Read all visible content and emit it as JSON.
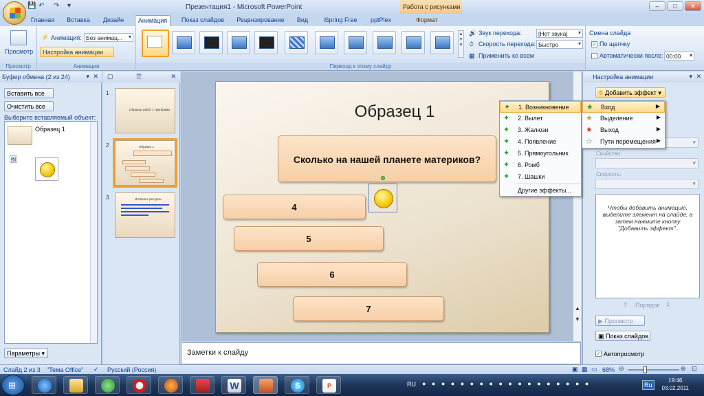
{
  "window": {
    "title": "Презентация1 - Microsoft PowerPoint",
    "context_tab": "Работа с рисунками"
  },
  "tabs": [
    "Главная",
    "Вставка",
    "Дизайн",
    "Анимация",
    "Показ слайдов",
    "Рецензирование",
    "Вид",
    "iSpring Free",
    "pptPlex",
    "Формат"
  ],
  "active_tab": "Анимация",
  "ribbon": {
    "preview_label": "Просмотр",
    "preview_group": "Просмотр",
    "animation_label": "Анимация:",
    "animation_value": "Без анимац...",
    "custom_anim_button": "Настройка анимации",
    "animation_group": "Анимация",
    "transition_sound_label": "Звук перехода:",
    "transition_sound_value": "[Нет звука]",
    "transition_speed_label": "Скорость перехода:",
    "transition_speed_value": "Быстро",
    "apply_all": "Применить ко всем",
    "transition_group": "Переход к этому слайду",
    "change_slide_label": "Смена слайда",
    "on_click_label": "По щелчку",
    "auto_after_label": "Автоматически после:",
    "auto_after_value": "00:00"
  },
  "clipboard": {
    "header": "Буфер обмена (2 из 24)",
    "paste_all": "Вставить все",
    "clear_all": "Очистить все",
    "choose_label": "Выберите вставляемый объект:",
    "item1_text": "Образец 1",
    "params_button": "Параметры"
  },
  "thumbnails": [
    {
      "num": "1",
      "text": "Образцы работ с тригерами"
    },
    {
      "num": "2",
      "text": "Образец 1"
    },
    {
      "num": "3",
      "text": "Интернет-ресурсы"
    }
  ],
  "slide": {
    "title": "Образец 1",
    "question": "Сколько на нашей планете материков?",
    "answers": [
      "4",
      "5",
      "6",
      "7"
    ]
  },
  "notes": {
    "placeholder": "Заметки к слайду"
  },
  "anim_pane": {
    "header": "Настройка анимации",
    "add_effect": "Добавить эффект",
    "property_label": "Свойство:",
    "speed_label": "Скорость:",
    "hint": "Чтобы добавить анимацию, выделите элемент на слайде, а затем нажмите кнопку \"Добавить эффект\".",
    "order_label": "Порядок",
    "preview_button": "Просмотр",
    "slideshow_button": "Показ слайдов",
    "autopreview_label": "Автопросмотр"
  },
  "entrance_menu": [
    "1. Возникновение",
    "2. Вылет",
    "3. Жалюзи",
    "4. Появление",
    "5. Прямоугольник",
    "6. Ромб",
    "7. Шашки",
    "Другие эффекты..."
  ],
  "add_effect_menu": [
    "Вход",
    "Выделение",
    "Выход",
    "Пути перемещения"
  ],
  "status": {
    "slide": "Слайд 2 из 3",
    "theme": "\"Тема Office\"",
    "language": "Русский (Россия)",
    "zoom": "68%"
  },
  "taskbar": {
    "lang": "RU",
    "time": "19:46",
    "date": "03.02.2011",
    "lang_badge": "Ru"
  },
  "colors": {
    "accent": "#f0a028",
    "ribbon": "#dbe7f6",
    "slide_box": "#fde4c8"
  }
}
